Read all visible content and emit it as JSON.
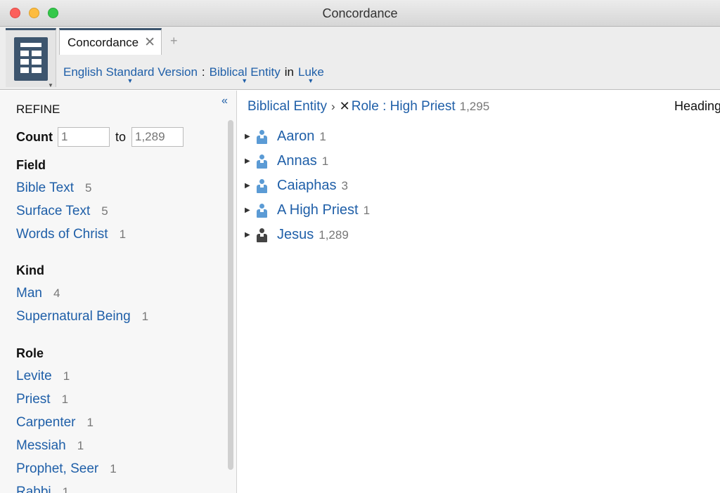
{
  "window": {
    "title": "Concordance"
  },
  "colors": {
    "link": "#1f5fa8",
    "accent": "#3d556e",
    "person_blue": "#5b9bd5",
    "person_dark": "#444444"
  },
  "toolbar": {
    "app_icon": "concordance-book-icon",
    "tab_label": "Concordance",
    "tab_close": "✕",
    "new_tab": "+",
    "breadcrumb": {
      "version": "English Standard Version",
      "sep": ":",
      "entity": "Biblical Entity",
      "in_word": "in",
      "book": "Luke"
    }
  },
  "refine": {
    "title": "REFINE",
    "collapse": "«",
    "count": {
      "label": "Count",
      "from_placeholder": "1",
      "to_label": "to",
      "to_placeholder": "1,289"
    },
    "sections": [
      {
        "heading": "Field",
        "items": [
          {
            "label": "Bible Text",
            "count": "5"
          },
          {
            "label": "Surface Text",
            "count": "5"
          },
          {
            "label": "Words of Christ",
            "count": "1"
          }
        ]
      },
      {
        "heading": "Kind",
        "items": [
          {
            "label": "Man",
            "count": "4"
          },
          {
            "label": "Supernatural Being",
            "count": "1"
          }
        ]
      },
      {
        "heading": "Role",
        "items": [
          {
            "label": "Levite",
            "count": "1"
          },
          {
            "label": "Priest",
            "count": "1"
          },
          {
            "label": "Carpenter",
            "count": "1"
          },
          {
            "label": "Messiah",
            "count": "1"
          },
          {
            "label": "Prophet, Seer",
            "count": "1"
          },
          {
            "label": "Rabbi",
            "count": "1"
          }
        ]
      }
    ]
  },
  "main": {
    "header": {
      "entity": "Biblical Entity",
      "chevron": "›",
      "remove": "✕",
      "filter": "Role : High Priest",
      "total": "1,295"
    },
    "heading_label": "Heading",
    "results": [
      {
        "name": "Aaron",
        "count": "1",
        "icon": "person-icon"
      },
      {
        "name": "Annas",
        "count": "1",
        "icon": "person-icon"
      },
      {
        "name": "Caiaphas",
        "count": "3",
        "icon": "person-icon"
      },
      {
        "name": "A High Priest",
        "count": "1",
        "icon": "person-icon"
      },
      {
        "name": "Jesus",
        "count": "1,289",
        "icon": "divine-person-icon"
      }
    ]
  }
}
